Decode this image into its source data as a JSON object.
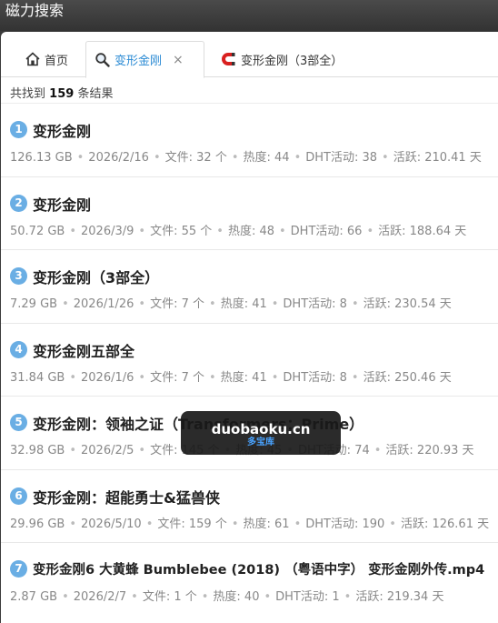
{
  "window": {
    "title": "磁力搜索"
  },
  "tabs": [
    {
      "label": "首页",
      "icon": "home-icon",
      "active": false
    },
    {
      "label": "变形金刚",
      "icon": "search-icon",
      "active": true,
      "close": "×"
    },
    {
      "label": "变形金刚（3部全）",
      "icon": "magnet-icon",
      "active": false
    }
  ],
  "summary": {
    "prefix": "共找到",
    "count": "159",
    "suffix": "条结果"
  },
  "results": [
    {
      "rank": "1",
      "title": "变形金刚",
      "size": "126.13 GB",
      "date": "2026/2/16",
      "files": "文件: 32 个",
      "heat": "热度: 44",
      "dht": "DHT活动: 38",
      "active": "活跃: 210.41 天"
    },
    {
      "rank": "2",
      "title": "变形金刚",
      "size": "50.72 GB",
      "date": "2026/3/9",
      "files": "文件: 55 个",
      "heat": "热度: 48",
      "dht": "DHT活动: 66",
      "active": "活跃: 188.64 天"
    },
    {
      "rank": "3",
      "title": "变形金刚（3部全）",
      "size": "7.29 GB",
      "date": "2026/1/26",
      "files": "文件: 7 个",
      "heat": "热度: 41",
      "dht": "DHT活动: 8",
      "active": "活跃: 230.54 天"
    },
    {
      "rank": "4",
      "title": "变形金刚五部全",
      "size": "31.84 GB",
      "date": "2026/1/6",
      "files": "文件: 7 个",
      "heat": "热度: 41",
      "dht": "DHT活动: 8",
      "active": "活跃: 250.46 天"
    },
    {
      "rank": "5",
      "title": "变形金刚：领袖之证（Transformers：Prime）",
      "size": "32.98 GB",
      "date": "2026/2/5",
      "files": "文件: 145 个",
      "heat": "热度: 45",
      "dht": "DHT活动: 74",
      "active": "活跃: 220.93 天"
    },
    {
      "rank": "6",
      "title": "变形金刚：超能勇士&猛兽侠",
      "size": "29.96 GB",
      "date": "2026/5/10",
      "files": "文件: 159 个",
      "heat": "热度: 61",
      "dht": "DHT活动: 190",
      "active": "活跃: 126.61 天"
    },
    {
      "rank": "7",
      "title": "变形金刚6 大黄蜂 Bumblebee (2018) （粤语中字） 变形金刚外传.mp4",
      "size": "2.87 GB",
      "date": "2026/2/7",
      "files": "文件: 1 个",
      "heat": "热度: 40",
      "dht": "DHT活动: 1",
      "active": "活跃: 219.34 天"
    }
  ],
  "watermark": {
    "main": "duobaoku.cn",
    "sub": "多宝库"
  },
  "colors": {
    "accent": "#6aaee4",
    "tab_active_text": "#2a8ad4",
    "meta": "#888888"
  }
}
